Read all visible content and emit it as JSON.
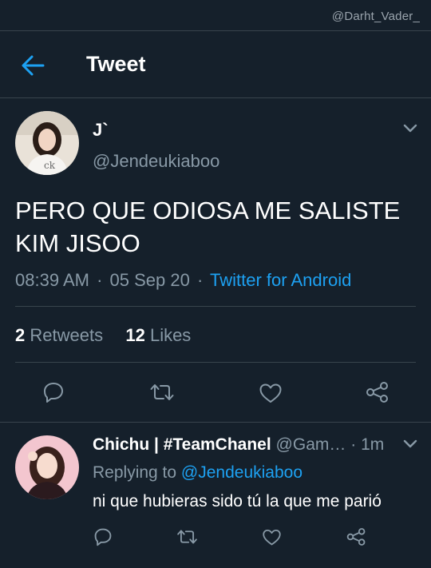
{
  "watermark": "@Darht_Vader_",
  "header": {
    "title": "Tweet",
    "back_icon": "arrow-left-icon"
  },
  "tweet": {
    "author_name": "J`",
    "author_handle": "@Jendeukiaboo",
    "text_line1": "PERO QUE ODIOSA ME SALISTE",
    "text_line2": "KIM JISOO",
    "time": "08:39 AM",
    "date": "05 Sep 20",
    "separator": "·",
    "source": "Twitter for Android",
    "retweets_count": "2",
    "retweets_label": "Retweets",
    "likes_count": "12",
    "likes_label": "Likes",
    "actions": [
      "reply-icon",
      "retweet-icon",
      "like-icon",
      "share-icon"
    ]
  },
  "reply": {
    "name": "Chichu | #TeamChanel",
    "handle": "@Gam…",
    "separator": "·",
    "time": "1m",
    "replying_prefix": "Replying to",
    "replying_to": "@Jendeukiaboo",
    "text": "ni que hubieras sido tú la que me parió",
    "actions": [
      "reply-icon",
      "retweet-icon",
      "like-icon",
      "share-icon"
    ]
  },
  "colors": {
    "background": "#15202b",
    "divider": "#38444d",
    "accent": "#1da1f2",
    "secondary_text": "#8899a6",
    "icon": "#8899a6"
  }
}
